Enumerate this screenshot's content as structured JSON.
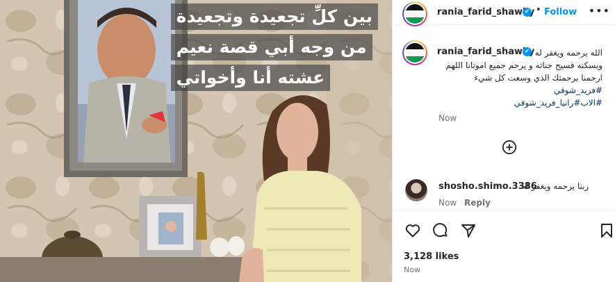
{
  "media": {
    "caption_lines": [
      "بين كلِّ تجعيدة وتجعيدة",
      "من وجه أبي قصة نعيم",
      "عشته أنا وأخواتي"
    ]
  },
  "header": {
    "username": "rania_farid_shawky",
    "verified_icon": "✔",
    "separator": "•",
    "follow_label": "Follow",
    "more_icon": "•••"
  },
  "caption": {
    "username": "rania_farid_shawky",
    "verified_icon": "✔",
    "lines": [
      "الله يرحمه ويغفر له",
      "ويسكنه فسيح جناته و يرحم جميع اموتانا اللهم",
      "ارحمنا برحمتك الذي وسعت كل شيء"
    ],
    "hashtags": [
      "#فريد_شوقي",
      "#الاب#رانيا_فريد_شوقي"
    ],
    "time": "Now"
  },
  "comment": {
    "username": "shosho.shimo.3386",
    "text": "ربنا يرحمه ويغفر له",
    "time": "Now",
    "reply_label": "Reply"
  },
  "actions": {
    "likes": "3,128 likes",
    "time": "Now"
  },
  "colors": {
    "accent": "#0095f6",
    "hashtag": "#00376b",
    "muted": "#737373"
  }
}
